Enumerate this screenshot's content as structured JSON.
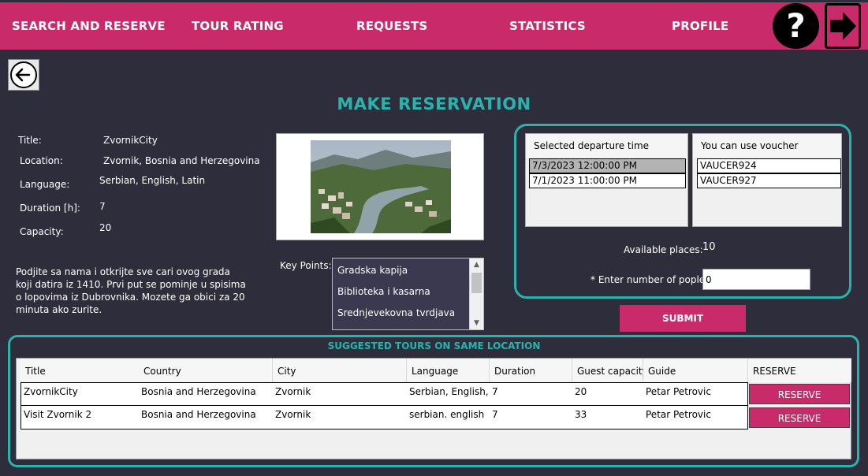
{
  "nav": {
    "search_reserve": "SEARCH AND RESERVE",
    "tour_rating": "TOUR RATING",
    "requests": "REQUESTS",
    "statistics": "STATISTICS",
    "profile": "PROFILE",
    "help": "?"
  },
  "page_title": "MAKE RESERVATION",
  "tour": {
    "title_label": "Title:",
    "title": "ZvornikCity",
    "location_label": "Location:",
    "location": "Zvornik, Bosnia and Herzegovina",
    "language_label": "Language:",
    "language": "Serbian, English, Latin",
    "duration_label": "Duration [h]:",
    "duration": "7",
    "capacity_label": "Capacity:",
    "capacity": "20",
    "description": "Podjite sa nama i otkrijte sve cari ovog grada koji datira iz 1410. Prvi put se pominje u spisima o lopovima iz Dubrovnika. Mozete ga obici za 20 minuta ako zurite."
  },
  "key_points": {
    "label": "Key Points:",
    "items": [
      "Gradska kapija",
      "Biblioteka i kasarna",
      "Srednjevekovna tvrdjava"
    ]
  },
  "departure": {
    "header": "Selected departure time",
    "items": [
      "7/3/2023 12:00:00 PM",
      "7/1/2023 11:00:00 PM"
    ]
  },
  "voucher": {
    "header": "You can use voucher",
    "items": [
      "VAUCER924",
      "VAUCER927"
    ]
  },
  "available_label": "Available places:",
  "available_value": "10",
  "people_label": "* Enter number of pople:",
  "people_value": "0",
  "submit_label": "SUBMIT",
  "suggested": {
    "title": "SUGGESTED TOURS ON SAME LOCATION",
    "columns": [
      "Title",
      "Country",
      "City",
      "Language",
      "Duration",
      "Guest capacity",
      "Guide",
      "RESERVE"
    ],
    "rows": [
      [
        "ZvornikCity",
        "Bosnia and Herzegovina",
        "Zvornik",
        "Serbian, English, Latin",
        "7",
        "20",
        "Petar Petrovic"
      ],
      [
        "Visit Zvornik 2",
        "Bosnia and Herzegovina",
        "Zvornik",
        "serbian. english",
        "7",
        "33",
        "Petar Petrovic"
      ]
    ],
    "reserve_label": "RESERVE"
  },
  "colors": {
    "accent": "#c92b6a",
    "teal": "#2ab3ad",
    "background": "#2e2d3c"
  }
}
